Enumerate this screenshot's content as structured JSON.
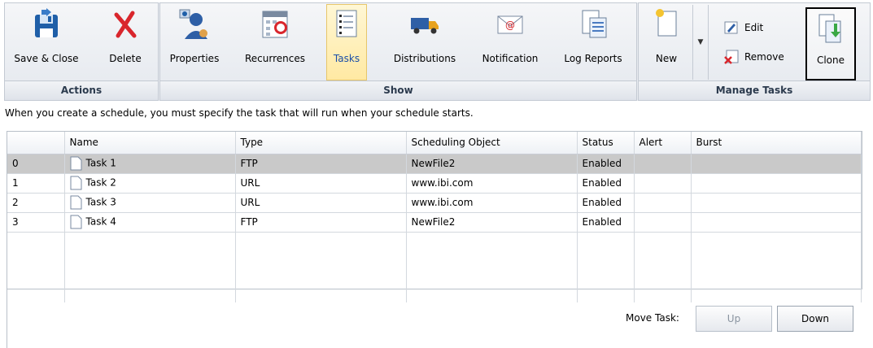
{
  "ribbon": {
    "groups": {
      "actions": {
        "label": "Actions"
      },
      "show": {
        "label": "Show"
      },
      "manage": {
        "label": "Manage Tasks"
      }
    },
    "buttons": {
      "save_close": "Save & Close",
      "delete": "Delete",
      "properties": "Properties",
      "recurrences": "Recurrences",
      "tasks": "Tasks",
      "distributions": "Distributions",
      "notification": "Notification",
      "log_reports": "Log Reports",
      "new": "New",
      "edit": "Edit",
      "remove": "Remove",
      "clone": "Clone"
    },
    "active_button": "Tasks",
    "highlighted_button": "Clone"
  },
  "info_text": "When you create a schedule, you must specify the task that will run when your schedule starts.",
  "table": {
    "columns": [
      "",
      "Name",
      "Type",
      "Scheduling Object",
      "Status",
      "Alert",
      "Burst"
    ],
    "rows": [
      {
        "index": "0",
        "name": "Task 1",
        "type": "FTP",
        "object": "NewFile2",
        "status": "Enabled",
        "alert": "",
        "burst": ""
      },
      {
        "index": "1",
        "name": "Task 2",
        "type": "URL",
        "object": "www.ibi.com",
        "status": "Enabled",
        "alert": "",
        "burst": ""
      },
      {
        "index": "2",
        "name": "Task 3",
        "type": "URL",
        "object": "www.ibi.com",
        "status": "Enabled",
        "alert": "",
        "burst": ""
      },
      {
        "index": "3",
        "name": "Task 4",
        "type": "FTP",
        "object": "NewFile2",
        "status": "Enabled",
        "alert": "",
        "burst": ""
      }
    ],
    "selected_row": "0"
  },
  "move_task": {
    "label": "Move Task:",
    "up": "Up",
    "down": "Down"
  },
  "colors": {
    "selected_row": "#c9c9c9",
    "active_tab": "#ffe9a3",
    "group_label_text": "#2b3a4d"
  }
}
